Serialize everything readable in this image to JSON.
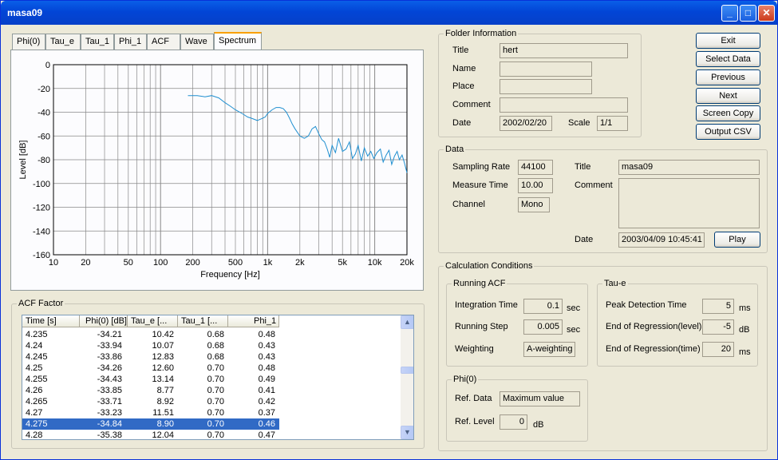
{
  "window": {
    "title": "masa09"
  },
  "tabs": [
    "Phi(0)",
    "Tau_e",
    "Tau_1",
    "Phi_1",
    "ACF",
    "Wave",
    "Spectrum"
  ],
  "active_tab": "Spectrum",
  "chart_data": {
    "type": "line",
    "xlabel": "Frequency [Hz]",
    "ylabel": "Level [dB]",
    "x_scale": "log",
    "xlim": [
      10,
      20000
    ],
    "ylim": [
      -160,
      0
    ],
    "xticks": [
      "10",
      "20",
      "50",
      "100",
      "200",
      "500",
      "1k",
      "2k",
      "5k",
      "10k",
      "20k"
    ],
    "yticks": [
      "0",
      "-20",
      "-40",
      "-60",
      "-80",
      "-100",
      "-120",
      "-140",
      "-160"
    ],
    "grid": true,
    "line_color": "#1f8fd0",
    "series": [
      {
        "x": [
          180,
          220,
          260,
          300,
          350,
          400,
          450,
          500,
          550,
          600,
          650,
          700,
          750,
          800,
          850,
          900,
          950,
          1000,
          1100,
          1200,
          1300,
          1400,
          1500,
          1600,
          1700,
          1800,
          2000,
          2200,
          2400,
          2600,
          2800,
          3000,
          3200,
          3400,
          3600,
          3800,
          4000,
          4300,
          4600,
          5000,
          5400,
          5800,
          6200,
          6600,
          7000,
          7500,
          8000,
          8600,
          9200,
          9800,
          10500,
          11300,
          12000,
          12800,
          13600,
          14400,
          15300,
          16200,
          17000,
          18000,
          19000,
          20000
        ],
        "y": [
          -26,
          -26,
          -27,
          -26,
          -28,
          -32,
          -35,
          -38,
          -40,
          -42,
          -44,
          -45,
          -46,
          -47,
          -46,
          -45,
          -44,
          -41,
          -38,
          -36,
          -36,
          -37,
          -40,
          -45,
          -50,
          -54,
          -60,
          -62,
          -60,
          -54,
          -52,
          -58,
          -63,
          -65,
          -71,
          -78,
          -68,
          -74,
          -62,
          -73,
          -71,
          -65,
          -79,
          -75,
          -68,
          -81,
          -70,
          -77,
          -73,
          -79,
          -74,
          -71,
          -82,
          -76,
          -72,
          -84,
          -77,
          -73,
          -80,
          -76,
          -83,
          -91
        ]
      }
    ]
  },
  "folder": {
    "group": "Folder Information",
    "title_label": "Title",
    "title": "hert",
    "name_label": "Name",
    "name": "",
    "place_label": "Place",
    "place": "",
    "comment_label": "Comment",
    "comment": "",
    "date_label": "Date",
    "date": "2002/02/20",
    "scale_label": "Scale",
    "scale": "1/1"
  },
  "buttons": {
    "exit": "Exit",
    "select": "Select Data",
    "previous": "Previous",
    "next": "Next",
    "screen_copy": "Screen Copy",
    "output_csv": "Output CSV"
  },
  "data": {
    "group": "Data",
    "sampling_label": "Sampling Rate",
    "sampling": "44100",
    "measure_label": "Measure Time",
    "measure": "10.00",
    "channel_label": "Channel",
    "channel": "Mono",
    "title_label": "Title",
    "title": "masa09",
    "comment_label": "Comment",
    "comment": "",
    "date_label": "Date",
    "date": "2003/04/09 10:45:41",
    "play": "Play"
  },
  "calc": {
    "group": "Calculation Conditions",
    "running": {
      "group": "Running ACF",
      "integration_label": "Integration Time",
      "integration": "0.1",
      "integration_unit": "sec",
      "step_label": "Running Step",
      "step": "0.005",
      "step_unit": "sec",
      "weighting_label": "Weighting",
      "weighting": "A-weighting"
    },
    "taue": {
      "group": "Tau-e",
      "peak_label": "Peak Detection Time",
      "peak": "5",
      "peak_unit": "ms",
      "end_level_label": "End of Regression(level)",
      "end_level": "-5",
      "end_level_unit": "dB",
      "end_time_label": "End of Regression(time)",
      "end_time": "20",
      "end_time_unit": "ms"
    },
    "phi0": {
      "group": "Phi(0)",
      "ref_data_label": "Ref. Data",
      "ref_data": "Maximum value",
      "ref_level_label": "Ref. Level",
      "ref_level": "0",
      "ref_level_unit": "dB"
    }
  },
  "acf": {
    "group": "ACF Factor",
    "headers": [
      "Time [s]",
      "Phi(0) [dB]",
      "Tau_e [...",
      "Tau_1 [...",
      "Phi_1"
    ],
    "rows": [
      [
        "4.235",
        "-34.21",
        "10.42",
        "0.68",
        "0.48"
      ],
      [
        "4.24",
        "-33.94",
        "10.07",
        "0.68",
        "0.43"
      ],
      [
        "4.245",
        "-33.86",
        "12.83",
        "0.68",
        "0.43"
      ],
      [
        "4.25",
        "-34.26",
        "12.60",
        "0.70",
        "0.48"
      ],
      [
        "4.255",
        "-34.43",
        "13.14",
        "0.70",
        "0.49"
      ],
      [
        "4.26",
        "-33.85",
        "8.77",
        "0.70",
        "0.41"
      ],
      [
        "4.265",
        "-33.71",
        "8.92",
        "0.70",
        "0.42"
      ],
      [
        "4.27",
        "-33.23",
        "11.51",
        "0.70",
        "0.37"
      ],
      [
        "4.275",
        "-34.84",
        "8.90",
        "0.70",
        "0.46"
      ],
      [
        "4.28",
        "-35.38",
        "12.04",
        "0.70",
        "0.47"
      ]
    ],
    "selected_index": 8
  }
}
